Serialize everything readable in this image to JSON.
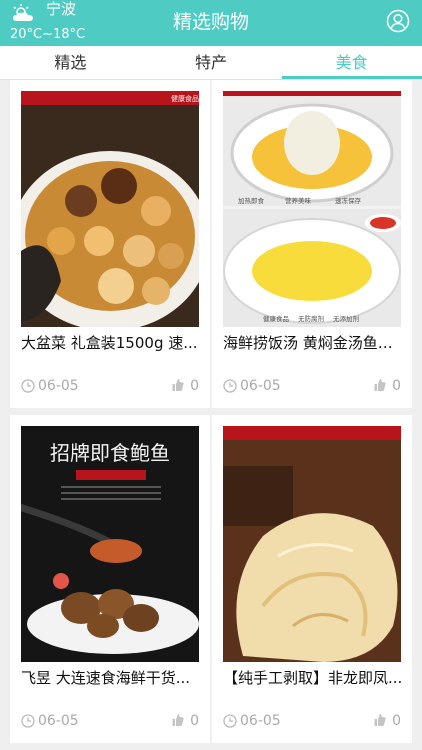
{
  "header": {
    "city": "宁波",
    "temperature": "20°C~18°C",
    "title": "精选购物",
    "weather_icon": "cloud-sun-icon",
    "user_icon": "user-icon",
    "accent_color": "#4ecbc3"
  },
  "tabs": [
    {
      "label": "精选",
      "active": false
    },
    {
      "label": "特产",
      "active": false
    },
    {
      "label": "美食",
      "active": true
    }
  ],
  "cards": [
    {
      "title": "大盆菜 礼盒装1500g 速...",
      "date": "06-05",
      "likes": "0",
      "image_text": [
        "健康食品"
      ]
    },
    {
      "title": "海鲜捞饭汤 黄焖金汤鱼刺...",
      "date": "06-05",
      "likes": "0",
      "image_text": [
        "加热即食",
        "营养美味",
        "速冻保存",
        "健康食品",
        "无防腐剂",
        "无添加剂"
      ]
    },
    {
      "title": "飞昱 大连速食海鲜干货...",
      "date": "06-05",
      "likes": "0",
      "image_text": [
        "招牌即食鲍鱼"
      ]
    },
    {
      "title": "【纯手工剥取】非龙即凤...",
      "date": "06-05",
      "likes": "0",
      "image_text": []
    }
  ]
}
